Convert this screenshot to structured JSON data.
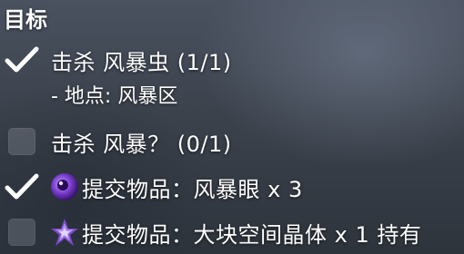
{
  "quest": {
    "title": "目标",
    "objectives": [
      {
        "text": "击杀 风暴虫  (1/1)",
        "done": true
      },
      {
        "text": "- 地点: 风暴区",
        "sub": true
      },
      {
        "text": "击杀 风暴？  (0/1)",
        "done": false
      },
      {
        "text": "提交物品：风暴眼 x 3",
        "done": true,
        "icon": "storm-eye-icon"
      },
      {
        "text": "提交物品：大块空间晶体 x 1 持有",
        "done": false,
        "icon": "space-crystal-icon"
      }
    ]
  },
  "colors": {
    "check": "#ffffff",
    "storm_eye": "#7b3fd0",
    "space_crystal": "#7a4cc8"
  }
}
